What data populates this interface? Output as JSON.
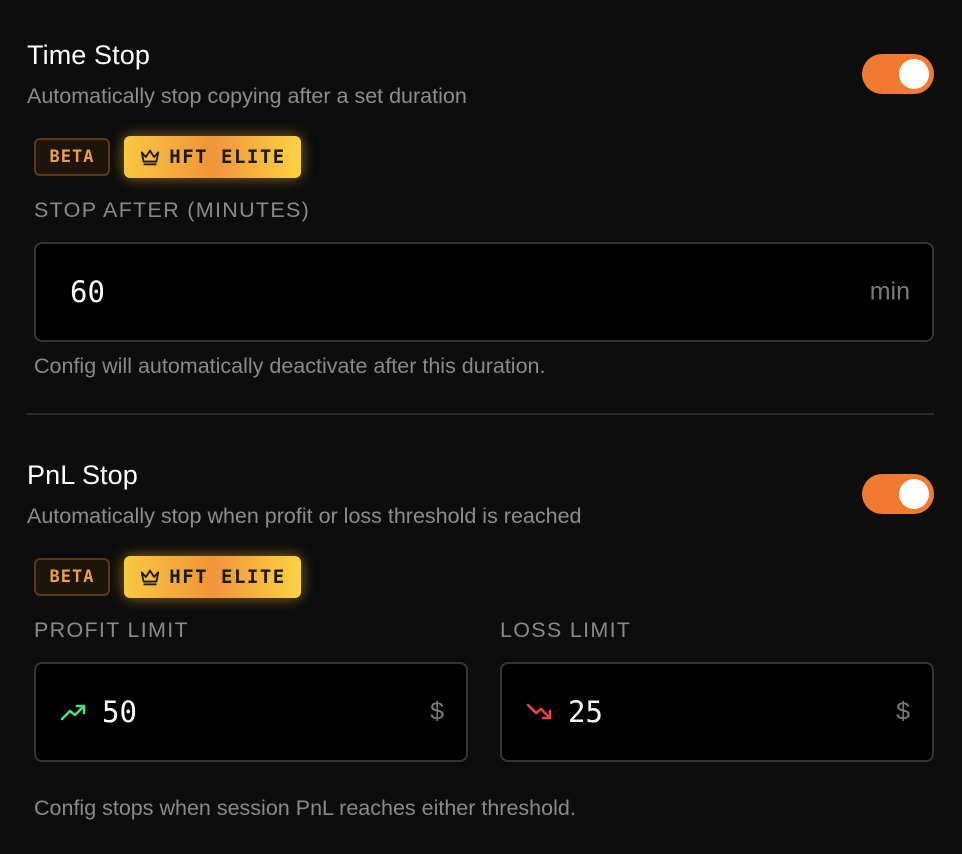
{
  "time_stop": {
    "title": "Time Stop",
    "subtitle": "Automatically stop copying after a set duration",
    "enabled": true,
    "badges": {
      "beta": "BETA",
      "elite": "HFT ELITE"
    },
    "field_label": "STOP AFTER (MINUTES)",
    "value": "60",
    "unit": "min",
    "helper": "Config will automatically deactivate after this duration."
  },
  "pnl_stop": {
    "title": "PnL Stop",
    "subtitle": "Automatically stop when profit or loss threshold is reached",
    "enabled": true,
    "badges": {
      "beta": "BETA",
      "elite": "HFT ELITE"
    },
    "profit": {
      "label": "PROFIT LIMIT",
      "value": "50",
      "unit": "$",
      "icon": "trending-up-icon"
    },
    "loss": {
      "label": "LOSS LIMIT",
      "value": "25",
      "unit": "$",
      "icon": "trending-down-icon"
    },
    "helper": "Config stops when session PnL reaches either threshold."
  },
  "colors": {
    "background": "#0d0d0d",
    "accent": "#f07a30",
    "elite_gold": "#f9c93f",
    "profit_green": "#4ade80",
    "loss_red": "#ef4444"
  }
}
